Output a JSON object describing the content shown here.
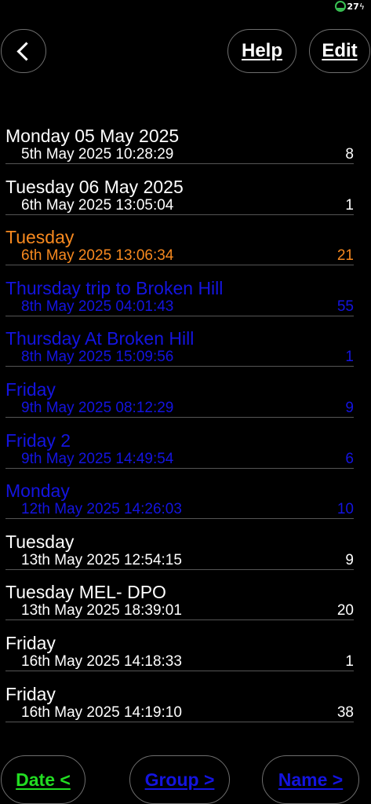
{
  "status_bar": {
    "battery_level": "27",
    "battery_fraction": 0.27,
    "battery_color": "#39c153"
  },
  "nav": {
    "back_icon": "chevron-left-icon",
    "help_label": "Help",
    "edit_label": "Edit"
  },
  "list": {
    "items": [
      {
        "title": "Monday 05 May 2025",
        "subtitle": "5th May 2025 10:28:29",
        "count": "8",
        "color": "#ffffff"
      },
      {
        "title": "Tuesday 06 May 2025",
        "subtitle": "6th May 2025 13:05:04",
        "count": "1",
        "color": "#ffffff"
      },
      {
        "title": "Tuesday",
        "subtitle": "6th May 2025 13:06:34",
        "count": "21",
        "color": "#f7891f"
      },
      {
        "title": "Thursday trip to Broken Hill",
        "subtitle": "8th May 2025 04:01:43",
        "count": "55",
        "color": "#1414e0"
      },
      {
        "title": "Thursday At Broken Hill",
        "subtitle": "8th May 2025 15:09:56",
        "count": "1",
        "color": "#1414e0"
      },
      {
        "title": "Friday",
        "subtitle": "9th May 2025 08:12:29",
        "count": "9",
        "color": "#1414e0"
      },
      {
        "title": "Friday 2",
        "subtitle": "9th May 2025 14:49:54",
        "count": "6",
        "color": "#1414e0"
      },
      {
        "title": "Monday",
        "subtitle": "12th May 2025 14:26:03",
        "count": "10",
        "color": "#1414e0"
      },
      {
        "title": "Tuesday",
        "subtitle": "13th May 2025 12:54:15",
        "count": "9",
        "color": "#ffffff"
      },
      {
        "title": "Tuesday MEL- DPO",
        "subtitle": "13th May 2025 18:39:01",
        "count": "20",
        "color": "#ffffff"
      },
      {
        "title": "Friday",
        "subtitle": "16th May 2025 14:18:33",
        "count": "1",
        "color": "#ffffff"
      },
      {
        "title": "Friday",
        "subtitle": "16th May 2025 14:19:10",
        "count": "38",
        "color": "#ffffff"
      }
    ]
  },
  "sort_bar": {
    "date_label": "Date <",
    "date_color": "#22dd22",
    "group_label": "Group >",
    "group_color": "#1414e0",
    "name_label": "Name >",
    "name_color": "#1414e0"
  }
}
